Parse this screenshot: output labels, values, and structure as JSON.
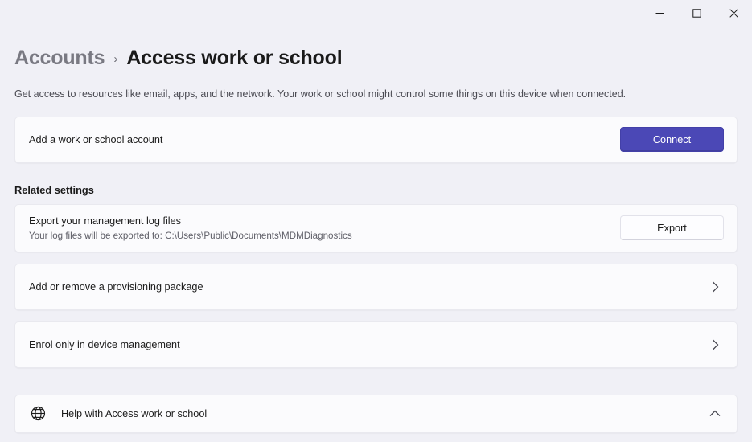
{
  "window": {
    "controls": [
      {
        "name": "minimize-button",
        "glyph": "minimize"
      },
      {
        "name": "maximize-button",
        "glyph": "maximize"
      },
      {
        "name": "close-button",
        "glyph": "close"
      }
    ]
  },
  "breadcrumb": {
    "parent": "Accounts",
    "separator": "›",
    "current": "Access work or school"
  },
  "page": {
    "description": "Get access to resources like email, apps, and the network. Your work or school might control some things on this device when connected."
  },
  "connect_card": {
    "title": "Add a work or school account",
    "button_label": "Connect"
  },
  "related_settings": {
    "heading": "Related settings",
    "export_card": {
      "title": "Export your management log files",
      "subtitle": "Your log files will be exported to: C:\\Users\\Public\\Documents\\MDMDiagnostics",
      "button_label": "Export"
    },
    "nav_rows": [
      {
        "title": "Add or remove a provisioning package",
        "icon": "chevron-right-icon"
      },
      {
        "title": "Enrol only in device management",
        "icon": "chevron-right-icon"
      }
    ]
  },
  "help_card": {
    "icon": "globe-icon",
    "label": "Help with Access work or school",
    "toggle_icon": "chevron-up-icon"
  },
  "colors": {
    "page_background": "#f0f0f6",
    "card_background": "#fbfbfd",
    "accent": "#4b48b6",
    "text_primary": "#1b1b1b",
    "text_secondary": "#5d5d66"
  }
}
